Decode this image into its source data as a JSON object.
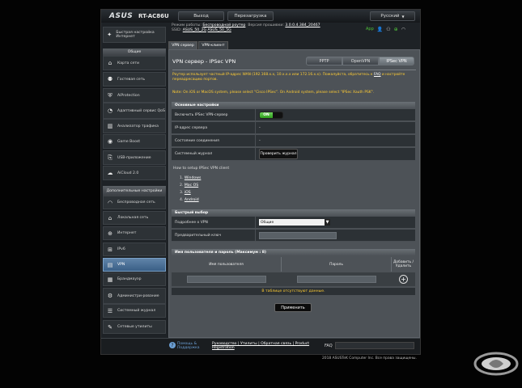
{
  "header": {
    "logo": "ASUS",
    "model": "RT-AC86U",
    "logout": "Выход",
    "reboot": "Перезагрузка",
    "language": "Русский"
  },
  "status": {
    "mode_label": "Режим работы:",
    "mode_value": "Беспроводной роутер",
    "firmware_label": "Версия прошивки:",
    "firmware_value": "3.0.0.4.384_20467",
    "ssid_label": "SSID:",
    "ssid_1": "ASUS_50_2G",
    "ssid_2": "ASUS_50_5G",
    "app_label": "App"
  },
  "sidebar": {
    "quick_setup": "Быстрая настройка Интернет",
    "general_header": "Общие",
    "general_items": [
      "Карта сети",
      "Гостевая сеть",
      "AiProtection",
      "Адаптивный сервис QoS",
      "Анализатор трафика",
      "Game Boost",
      "USB-приложение",
      "AiCloud 2.0"
    ],
    "advanced_header": "Дополнительные настройки",
    "advanced_items": [
      "Беспроводная сеть",
      "Локальная сеть",
      "Интернет",
      "IPv6",
      "VPN",
      "Брандмауэр",
      "Администри-рование",
      "Системный журнал",
      "Сетевые утилиты"
    ]
  },
  "tabs": {
    "vpn_server": "VPN сервер",
    "vpn_client": "VPN-клиент"
  },
  "page": {
    "title": "VPN сервер - IPSec VPN",
    "seg_pptp": "PPTP",
    "seg_openvpn": "OpenVPN",
    "seg_ipsec": "IPSec VPN",
    "note1": "Роутер использует частный IP-адрес WAN (192.168.x.x, 10.x.x.x или 172.16.x.x). Пожалуйста, обратитесь к",
    "note1_link": "FAQ",
    "note1_end": "и настройте переадресацию портов.",
    "note2": "Note: On iOS or MacOS system, please select \"Cisco IPSec\". On Android system, please select \"IPSec Xauth PSK\"."
  },
  "basic": {
    "header": "Основные настройки",
    "enable_label": "Включить IPSec VPN-сервер",
    "enable_value": "ON",
    "ip_label": "IP-адрес сервера",
    "ip_value": "-",
    "conn_label": "Состояние соединения",
    "conn_value": "-",
    "log_label": "Системный журнал",
    "log_button": "Проверить журнал"
  },
  "howto": {
    "title": "How to setup IPSec VPN client",
    "items": [
      "1. ",
      "2. ",
      "3. ",
      "4. "
    ],
    "links": [
      "Windows",
      "Mac OS",
      "iOS",
      "Android"
    ]
  },
  "quick": {
    "header": "Быстрый выбор",
    "vpn_details_label": "Подробнее о VPN",
    "vpn_details_value": "Общие",
    "psk_label": "Предварительный ключ"
  },
  "users": {
    "header": "Имя пользователя и пароль (Максимум : 8)",
    "col_user": "Имя пользователя",
    "col_pass": "Пароль",
    "col_action": "Добавить / Удалить",
    "empty": "В таблице отсутствуют данные."
  },
  "apply": "Применить",
  "footer": {
    "help": "Помощь & Поддержка",
    "links": "Руководство | Утилиты | Обратная связь | Product Registration",
    "faq": "FAQ",
    "copyright": "2018 ASUSTeK Computer Inc. Все права защищены."
  }
}
